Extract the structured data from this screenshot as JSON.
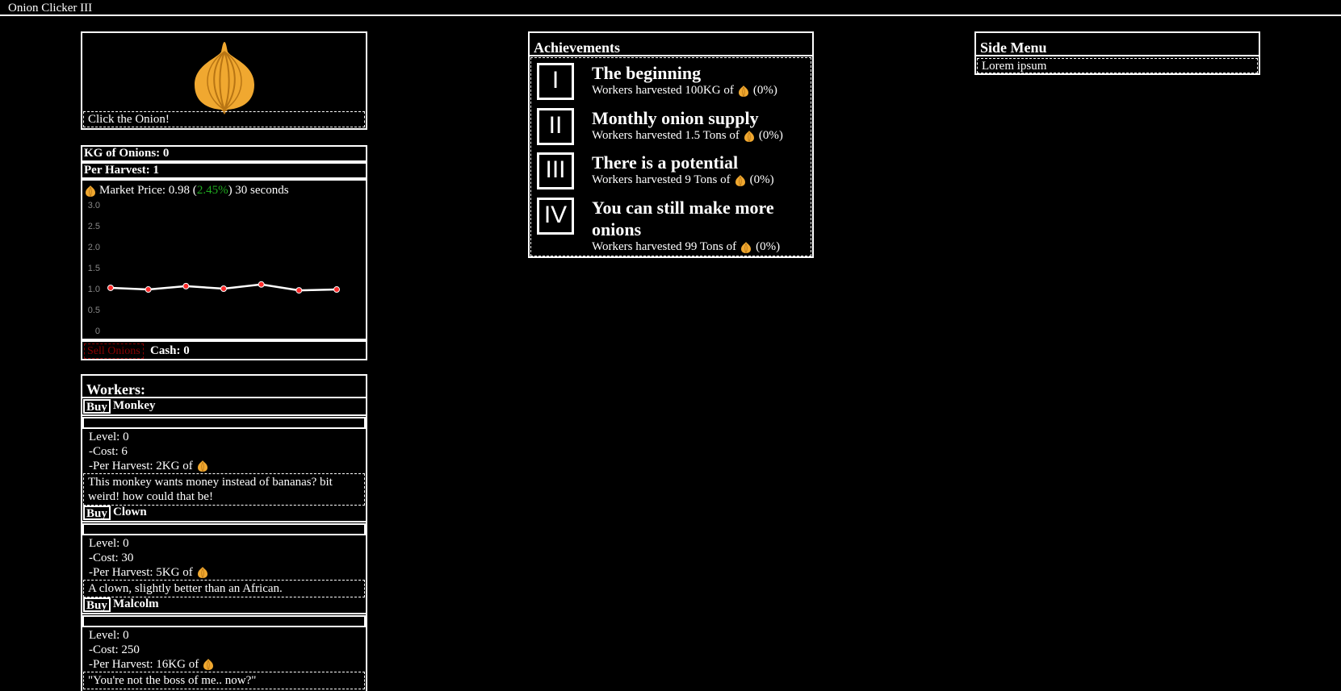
{
  "app": {
    "title": "Onion Clicker III"
  },
  "onion": {
    "click_label": "Click the Onion!"
  },
  "stats": {
    "kg_label": "KG of Onions: 0",
    "per_harvest_label": "Per Harvest: 1"
  },
  "market": {
    "price_prefix": "Market Price: 0.98 (",
    "change": "2.45%",
    "price_suffix": ") 30 seconds",
    "change_color": "#1fa81f"
  },
  "chart_data": {
    "type": "line",
    "y_ticks": [
      "3.0",
      "2.5",
      "2.0",
      "1.5",
      "1.0",
      "0.5",
      "0"
    ],
    "ylim": [
      0,
      3.0
    ],
    "values": [
      1.02,
      0.98,
      1.06,
      1.0,
      1.1,
      0.96,
      0.98
    ],
    "line_color": "#ffffff",
    "point_color": "#ff2a2a"
  },
  "sell": {
    "button_label": "Sell Onions",
    "cash_label": "Cash: 0"
  },
  "workers": {
    "title": "Workers:",
    "buy_label": "Buy",
    "items": [
      {
        "name": "Monkey",
        "level": "Level: 0",
        "cost": "-Cost: 6",
        "per_harvest": "-Per Harvest: 2KG of",
        "description": "This monkey wants money instead of bananas? bit weird! how could that be!"
      },
      {
        "name": "Clown",
        "level": "Level: 0",
        "cost": "-Cost: 30",
        "per_harvest": "-Per Harvest: 5KG of",
        "description": "A clown, slightly better than an African."
      },
      {
        "name": "Malcolm",
        "level": "Level: 0",
        "cost": "-Cost: 250",
        "per_harvest": "-Per Harvest: 16KG of",
        "description": "\"You're not the boss of me.. now?\""
      }
    ]
  },
  "achievements": {
    "title": "Achievements",
    "items": [
      {
        "numeral": "I",
        "title": "The beginning",
        "desc": "Workers harvested 100KG of",
        "progress": "(0%)"
      },
      {
        "numeral": "II",
        "title": "Monthly onion supply",
        "desc": "Workers harvested 1.5 Tons of",
        "progress": "(0%)"
      },
      {
        "numeral": "III",
        "title": "There is a potential",
        "desc": "Workers harvested 9 Tons of",
        "progress": "(0%)"
      },
      {
        "numeral": "IV",
        "title": "You can still make more onions",
        "desc": "Workers harvested 99 Tons of",
        "progress": "(0%)"
      }
    ]
  },
  "side_menu": {
    "title": "Side Menu",
    "item": "Lorem ipsum"
  },
  "colors": {
    "onion": "#f0a830",
    "onion_dark": "#b87514",
    "sell": "#8b0000"
  }
}
